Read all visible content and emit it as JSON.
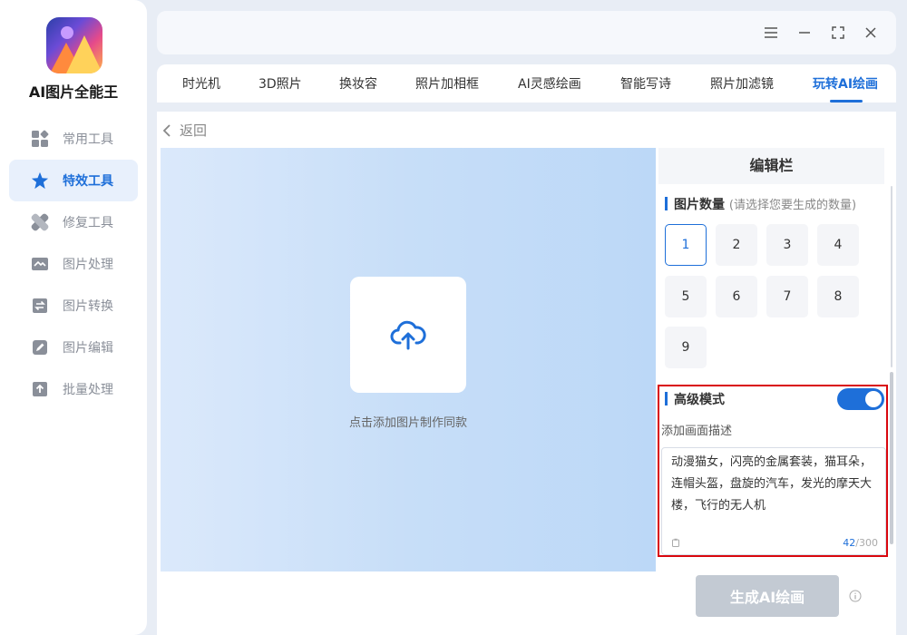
{
  "app": {
    "title": "AI图片全能王"
  },
  "sidebar": {
    "items": [
      {
        "label": "常用工具",
        "icon": "grid-icon",
        "active": false
      },
      {
        "label": "特效工具",
        "icon": "star-icon",
        "active": true
      },
      {
        "label": "修复工具",
        "icon": "bandage-icon",
        "active": false
      },
      {
        "label": "图片处理",
        "icon": "image-wave-icon",
        "active": false
      },
      {
        "label": "图片转换",
        "icon": "swap-icon",
        "active": false
      },
      {
        "label": "图片编辑",
        "icon": "edit-icon",
        "active": false
      },
      {
        "label": "批量处理",
        "icon": "upload-tray-icon",
        "active": false
      }
    ]
  },
  "window_controls": [
    "menu-icon",
    "minimize-icon",
    "maximize-icon",
    "close-icon"
  ],
  "tabs": [
    {
      "label": "时光机"
    },
    {
      "label": "3D照片"
    },
    {
      "label": "换妆容"
    },
    {
      "label": "照片加相框"
    },
    {
      "label": "AI灵感绘画"
    },
    {
      "label": "智能写诗"
    },
    {
      "label": "照片加滤镜"
    },
    {
      "label": "玩转AI绘画",
      "active": true
    }
  ],
  "main": {
    "back_label": "返回",
    "upload_hint": "点击添加图片制作同款"
  },
  "panel": {
    "title": "编辑栏",
    "count_section": {
      "title": "图片数量",
      "hint": "(请选择您要生成的数量)",
      "options": [
        "1",
        "2",
        "3",
        "4",
        "5",
        "6",
        "7",
        "8",
        "9"
      ],
      "selected": "1"
    },
    "advanced": {
      "title": "高级模式",
      "enabled": true,
      "desc_label": "添加画面描述",
      "text": "动漫猫女，闪亮的金属套装，猫耳朵，连帽头盔，盘旋的汽车，发光的摩天大楼，飞行的无人机",
      "count": "42",
      "max": "/300"
    },
    "generate_label": "生成AI绘画"
  },
  "colors": {
    "accent": "#1e6fd9",
    "highlight_border": "#d9070e",
    "disabled_button": "#c3cad3"
  }
}
